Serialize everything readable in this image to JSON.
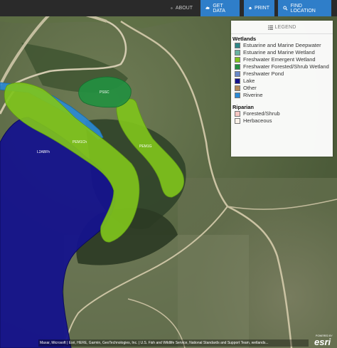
{
  "toolbar": {
    "about_label": "ABOUT",
    "get_data_label": "GET DATA",
    "print_label": "PRINT",
    "find_location_label": "FIND LOCATION"
  },
  "legend": {
    "header": "LEGEND",
    "wetlands_title": "Wetlands",
    "wetlands": [
      {
        "label": "Estuarine and Marine Deepwater",
        "color": "#2f8787"
      },
      {
        "label": "Estuarine and Marine Wetland",
        "color": "#68b3a0"
      },
      {
        "label": "Freshwater Emergent Wetland",
        "color": "#7fc31c"
      },
      {
        "label": "Freshwater Forested/Shrub Wetland",
        "color": "#238f40"
      },
      {
        "label": "Freshwater Pond",
        "color": "#6889c9"
      },
      {
        "label": "Lake",
        "color": "#15138c"
      },
      {
        "label": "Other",
        "color": "#b38857"
      },
      {
        "label": "Riverine",
        "color": "#2a8ad6"
      }
    ],
    "riparian_title": "Riparian",
    "riparian": [
      {
        "label": "Forested/Shrub",
        "color": "#f6c7c3"
      },
      {
        "label": "Herbaceous",
        "color": "#fbf2e8"
      }
    ]
  },
  "map": {
    "labels": {
      "lake": "L2ABFh",
      "pem_left": "PEM1Ch",
      "pem_right": "PEM1G",
      "pss": "PSSC"
    }
  },
  "attribution": "Maxar, Microsoft | Esri, HERE, Garmin, GeoTechnologies, Inc. | U.S. Fish and Wildlife Service, National Standards and Support Team, wetlands...",
  "esri": {
    "powered_by": "POWERED BY",
    "name": "esri"
  }
}
